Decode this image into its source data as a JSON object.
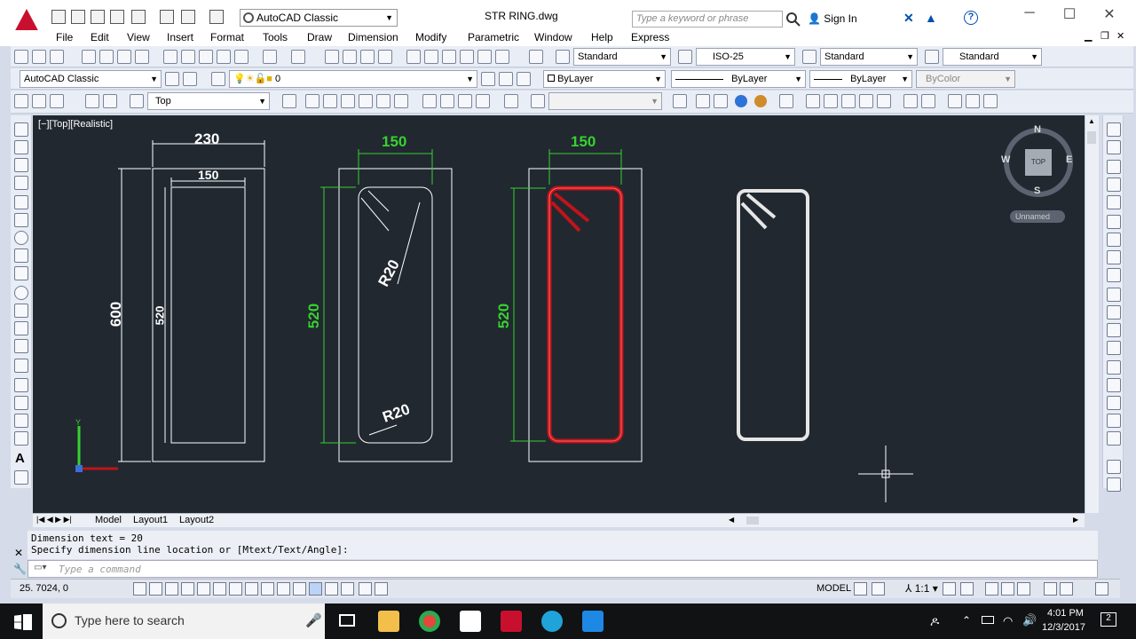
{
  "window": {
    "title": "STR RING.dwg",
    "workspace": "AutoCAD Classic",
    "search_placeholder": "Type a keyword or phrase",
    "sign_in": "Sign In"
  },
  "menu": [
    "File",
    "Edit",
    "View",
    "Insert",
    "Format",
    "Tools",
    "Draw",
    "Dimension",
    "Modify",
    "Parametric",
    "Window",
    "Help",
    "Express"
  ],
  "styles_toolbar": {
    "text_style": "Standard",
    "dim_style": "ISO-25",
    "table_style": "Standard",
    "mleader_style": "Standard"
  },
  "workspaces_toolbar": {
    "workspace": "AutoCAD Classic",
    "layer": "0",
    "color": "ByLayer",
    "linetype": "ByLayer",
    "lineweight": "ByLayer",
    "plotstyle": "ByColor"
  },
  "view_toolbar": {
    "view": "Top"
  },
  "viewport": {
    "label": "[−][Top][Realistic]"
  },
  "dimensions": {
    "d1_width": "230",
    "d1_inner_width": "150",
    "d1_height": "600",
    "d1_inner_height": "520",
    "d2_width": "150",
    "d2_height": "520",
    "d2_radius_top": "R20",
    "d2_radius_bottom": "R20",
    "d3_width": "150",
    "d3_height": "520"
  },
  "viewcube": {
    "north": "N",
    "south": "S",
    "east": "E",
    "west": "W",
    "face": "TOP",
    "ucs": "Unnamed"
  },
  "layout_tabs": [
    "Model",
    "Layout1",
    "Layout2"
  ],
  "command_line": {
    "history_1": "Dimension text = 20",
    "history_2": "Specify dimension line location or [Mtext/Text/Angle]:",
    "placeholder": "Type a command"
  },
  "status": {
    "coords": "25.  7024, 0",
    "space": "MODEL",
    "scale": "1:1"
  },
  "taskbar": {
    "search_placeholder": "Type here to search",
    "time": "4:01 PM",
    "date": "12/3/2017",
    "notifications": "2"
  },
  "colors": {
    "drawing_bg": "#212830",
    "dim_green": "#38d12f",
    "rebar_red": "#c0141a"
  }
}
